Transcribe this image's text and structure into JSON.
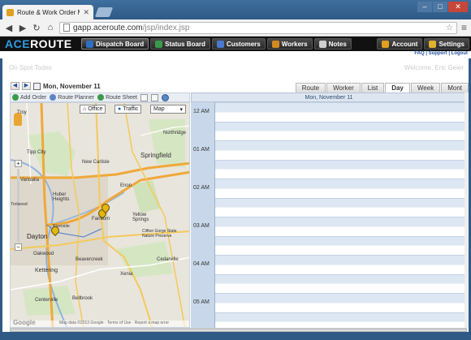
{
  "browser": {
    "tab_title": "Route & Work Order Ma…",
    "url_host": "gapp.aceroute.com",
    "url_path": "/jsp/index.jsp",
    "window_buttons": [
      "–",
      "□",
      "✕"
    ]
  },
  "app": {
    "logo_part1": "ACE",
    "logo_part2": "ROUTE",
    "nav": [
      {
        "label": "Dispatch Board",
        "icon": "dispatch-icon",
        "color": "#2f6fc2"
      },
      {
        "label": "Status Board",
        "icon": "status-icon",
        "color": "#3a9a4a"
      },
      {
        "label": "Customers",
        "icon": "customers-icon",
        "color": "#4a7ad0"
      },
      {
        "label": "Workers",
        "icon": "workers-icon",
        "color": "#d08a20"
      },
      {
        "label": "Notes",
        "icon": "notes-icon",
        "color": "#cfcfcf"
      }
    ],
    "nav_right": [
      {
        "label": "Account",
        "icon": "lock-icon",
        "color": "#e0a020"
      },
      {
        "label": "Settings",
        "icon": "settings-icon",
        "color": "#e0b030"
      }
    ],
    "sublinks": "FAQ | Support | Logout"
  },
  "page": {
    "site_line": "On Spot Todes",
    "welcome": "Welcome, Eric Geier"
  },
  "schedule": {
    "date_label": "Mon, November 11",
    "header_date": "Mon, November 11",
    "view_tabs": [
      "Route",
      "Worker",
      "List",
      "Day",
      "Week",
      "Mont"
    ],
    "active_view": "Day",
    "actions": [
      {
        "label": "Add Order",
        "icon": "add-order-icon",
        "color": "#3a9a4a"
      },
      {
        "label": "Route Planner",
        "icon": "route-planner-icon",
        "color": "#5a85c8"
      },
      {
        "label": "Route Sheet",
        "icon": "route-sheet-icon",
        "color": "#3a9a4a"
      }
    ],
    "time_labels": [
      "12 AM",
      "01 AM",
      "02 AM",
      "03 AM",
      "04 AM",
      "05 AM"
    ]
  },
  "map": {
    "btn_office": "Office",
    "btn_traffic": "Traffic",
    "map_type": "Map",
    "places": [
      "Troy",
      "Tipp City",
      "New Carlisle",
      "Vandalia",
      "Huber Heights",
      "Springfield",
      "Enon",
      "Dayton",
      "Riverside",
      "Fairborn",
      "Yellow Springs",
      "Clifton Gorge State Nature Preserve",
      "Oakwood",
      "Beavercreek",
      "Xenia",
      "Kettering",
      "Cedarville",
      "Centerville",
      "Bellbrook",
      "Northridge",
      "Trotwood"
    ],
    "footer": "Map data ©2013 Google · Terms of Use · Report a map error",
    "google": "Google"
  }
}
